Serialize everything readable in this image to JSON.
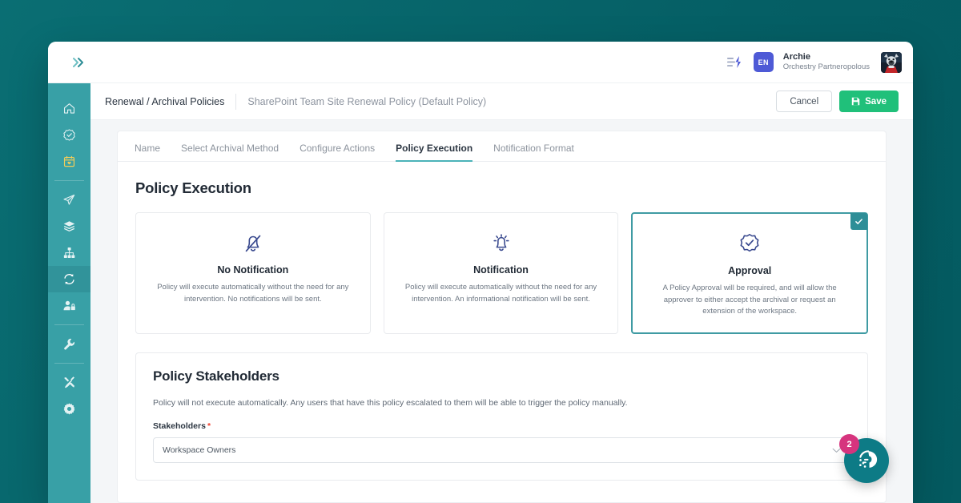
{
  "topbar": {
    "expand_icon": "double-chevron-right-icon",
    "quick_actions_icon": "lightning-list-icon",
    "language": "EN",
    "user_name": "Archie",
    "user_org": "Orchestry Partneropolous",
    "avatar_icon": "dog-avatar"
  },
  "sidebar": {
    "items": [
      {
        "icon": "home-icon",
        "name": "sidebar-item-home",
        "active": false
      },
      {
        "icon": "badge-check-icon",
        "name": "sidebar-item-approvals",
        "active": false
      },
      {
        "icon": "calendar-heart-icon",
        "name": "sidebar-item-calendar",
        "active": false,
        "accent": "#f2cd5a"
      },
      {
        "icon": "paper-plane-icon",
        "name": "sidebar-item-requests",
        "active": false
      },
      {
        "icon": "layers-icon",
        "name": "sidebar-item-templates",
        "active": false
      },
      {
        "icon": "sitemap-icon",
        "name": "sidebar-item-directory",
        "active": false
      },
      {
        "icon": "refresh-icon",
        "name": "sidebar-item-lifecycle",
        "active": true
      },
      {
        "icon": "user-lock-icon",
        "name": "sidebar-item-permissions",
        "active": false
      },
      {
        "icon": "wrench-icon",
        "name": "sidebar-item-tools",
        "active": false
      },
      {
        "icon": "tools-cross-icon",
        "name": "sidebar-item-maintenance",
        "active": false
      },
      {
        "icon": "gear-icon",
        "name": "sidebar-item-settings",
        "active": false
      }
    ]
  },
  "breadcrumb": {
    "primary": "Renewal / Archival Policies",
    "secondary": "SharePoint Team Site Renewal Policy (Default Policy)"
  },
  "actions": {
    "cancel_label": "Cancel",
    "save_label": "Save",
    "save_icon": "floppy-disk-icon"
  },
  "tabs": [
    {
      "label": "Name",
      "active": false
    },
    {
      "label": "Select Archival Method",
      "active": false
    },
    {
      "label": "Configure Actions",
      "active": false
    },
    {
      "label": "Policy Execution",
      "active": true
    },
    {
      "label": "Notification Format",
      "active": false
    }
  ],
  "main": {
    "section_title": "Policy Execution",
    "options": [
      {
        "icon": "bell-slash-icon",
        "title": "No Notification",
        "description": "Policy will execute automatically without the need for any intervention. No notifications will be sent.",
        "selected": false
      },
      {
        "icon": "bell-ringing-icon",
        "title": "Notification",
        "description": "Policy will execute automatically without the need for any intervention. An informational notification will be sent.",
        "selected": false
      },
      {
        "icon": "badge-check-circle-icon",
        "title": "Approval",
        "description": "A Policy Approval will be required, and will allow the approver to either accept the archival or request an extension of the workspace.",
        "selected": true
      }
    ],
    "stakeholders": {
      "title": "Policy Stakeholders",
      "description": "Policy will not execute automatically. Any users that have this policy escalated to them will be able to trigger the policy manually.",
      "field_label": "Stakeholders",
      "required_marker": "*",
      "selected_value": "Workspace Owners",
      "chevron_icon": "chevron-down-icon"
    }
  },
  "fab": {
    "icon": "orchestry-logo-icon",
    "badge_count": "2"
  },
  "colors": {
    "page_background": "#076065",
    "sidebar": "#38a0a6",
    "sidebar_active": "#31939a",
    "accent_teal": "#3f9ba3",
    "save_green": "#20c07a",
    "lang_badge": "#4e5ad6",
    "fab": "#0d7b86",
    "fab_badge": "#d6347e",
    "required_star": "#f0422f",
    "icon_navy": "#3a4a8f"
  }
}
